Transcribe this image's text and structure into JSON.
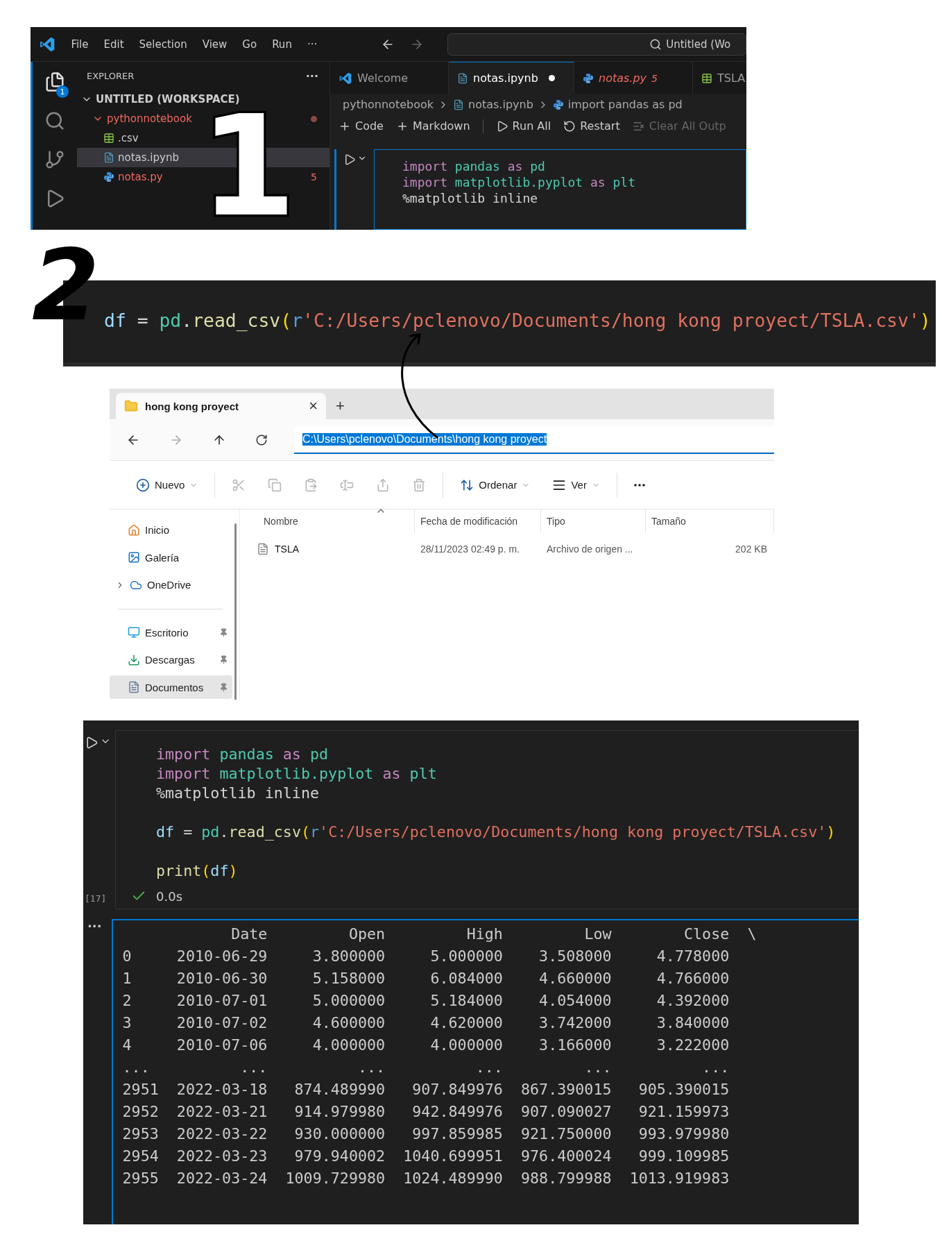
{
  "annotations": {
    "first": "1",
    "second": "2"
  },
  "vscode": {
    "menu": [
      "File",
      "Edit",
      "Selection",
      "View",
      "Go",
      "Run",
      "···"
    ],
    "search": "Untitled (Wo",
    "activity_badge": "1",
    "explorer": {
      "title": "EXPLORER",
      "more": "···",
      "workspace": "UNTITLED (WORKSPACE)",
      "tree": [
        {
          "label": "pythonnotebook",
          "kind": "folder",
          "expanded": true,
          "modified": true,
          "selected": false,
          "children": [
            {
              "label": ".csv",
              "kind": "csv",
              "selected": false
            },
            {
              "label": "notas.ipynb",
              "kind": "notebook",
              "selected": true
            },
            {
              "label": "notas.py",
              "kind": "python",
              "selected": false,
              "modified": true,
              "problems": "5"
            }
          ]
        }
      ]
    },
    "tabs": [
      {
        "label": "Welcome",
        "kind": "welcome",
        "selected": false,
        "dirty": false
      },
      {
        "label": "notas.ipynb",
        "kind": "notebook",
        "selected": true,
        "dirty": true
      },
      {
        "label": "notas.py",
        "kind": "python",
        "selected": false,
        "dirty": false,
        "problems": "5"
      },
      {
        "label": "TSLA.",
        "kind": "csv",
        "selected": false
      }
    ],
    "breadcrumbs": [
      {
        "label": "pythonnotebook",
        "kind": "folder"
      },
      {
        "label": "notas.ipynb",
        "kind": "notebook"
      },
      {
        "label": "import pandas as pd",
        "kind": "python"
      }
    ],
    "toolbar": [
      {
        "label": "Code",
        "kind": "add",
        "disabled": false
      },
      {
        "label": "Markdown",
        "kind": "add",
        "disabled": false
      },
      {
        "label": "Run All",
        "kind": "run",
        "disabled": false
      },
      {
        "label": "Restart",
        "kind": "restart",
        "disabled": false
      },
      {
        "label": "Clear All Outp",
        "kind": "clear",
        "disabled": true
      }
    ],
    "code": [
      {
        "kind": "code",
        "tokens": [
          {
            "kind": "keyword",
            "text": "import "
          },
          {
            "kind": "module",
            "text": "pandas "
          },
          {
            "kind": "keyword",
            "text": "as "
          },
          {
            "kind": "module",
            "text": "pd"
          }
        ]
      },
      {
        "kind": "code",
        "tokens": [
          {
            "kind": "keyword",
            "text": "import "
          },
          {
            "kind": "module",
            "text": "matplotlib.pyplot "
          },
          {
            "kind": "keyword",
            "text": "as "
          },
          {
            "kind": "alias",
            "text": "plt"
          }
        ]
      },
      {
        "kind": "code",
        "tokens": [
          {
            "kind": "plain",
            "text": "%matplotlib inline"
          }
        ]
      }
    ]
  },
  "zoomed_code": {
    "tokens": [
      {
        "kind": "variable",
        "text": "df"
      },
      {
        "kind": "plain",
        "text": " = "
      },
      {
        "kind": "module",
        "text": "pd"
      },
      {
        "kind": "plain",
        "text": "."
      },
      {
        "kind": "function",
        "text": "read_csv"
      },
      {
        "kind": "paren",
        "text": "("
      },
      {
        "kind": "prefix",
        "text": "r"
      },
      {
        "kind": "string",
        "text": "'C:/Users/pclenovo/Documents/hong kong proyect/TSLA.csv'"
      },
      {
        "kind": "paren",
        "text": ")"
      }
    ]
  },
  "file_explorer": {
    "tab": "hong kong proyect",
    "close": "×",
    "new_tab": "+",
    "address": "C:\\Users\\pclenovo\\Documents\\hong kong proyect",
    "toolbar": [
      {
        "kind": "new",
        "label": "Nuevo",
        "disabled": false
      },
      {
        "kind": "cut",
        "disabled": true
      },
      {
        "kind": "copy",
        "disabled": true
      },
      {
        "kind": "paste",
        "disabled": true
      },
      {
        "kind": "rename",
        "disabled": true
      },
      {
        "kind": "share",
        "disabled": true
      },
      {
        "kind": "delete",
        "disabled": true
      },
      {
        "kind": "sort",
        "label": "Ordenar",
        "disabled": false
      },
      {
        "kind": "view",
        "label": "Ver",
        "disabled": false
      },
      {
        "kind": "more",
        "disabled": false
      }
    ],
    "sidebar": [
      {
        "label": "Inicio",
        "kind": "home",
        "pinned": false,
        "selected": false
      },
      {
        "label": "Galería",
        "kind": "gallery",
        "pinned": false,
        "selected": false
      },
      {
        "label": "OneDrive",
        "kind": "cloud",
        "pinned": false,
        "selected": false,
        "expanded": false
      },
      {
        "label": "Escritorio",
        "kind": "desktop",
        "pinned": true,
        "selected": false
      },
      {
        "label": "Descargas",
        "kind": "downloads",
        "pinned": true,
        "selected": false
      },
      {
        "label": "Documentos",
        "kind": "documents",
        "pinned": true,
        "selected": true
      }
    ],
    "columns": [
      {
        "label": "Nombre",
        "sorted": true
      },
      {
        "label": "Fecha de modificación",
        "sorted": false
      },
      {
        "label": "Tipo",
        "sorted": false
      },
      {
        "label": "Tamaño",
        "sorted": false
      }
    ],
    "rows": [
      {
        "name": "TSLA",
        "modified": "28/11/2023 02:49 p. m.",
        "type": "Archivo de origen ...",
        "size": "202 KB",
        "selected": false
      }
    ]
  },
  "notebook": {
    "code": [
      {
        "kind": "code",
        "tokens": [
          {
            "kind": "keyword",
            "text": "import "
          },
          {
            "kind": "module",
            "text": "pandas "
          },
          {
            "kind": "keyword",
            "text": "as "
          },
          {
            "kind": "module",
            "text": "pd"
          }
        ]
      },
      {
        "kind": "code",
        "tokens": [
          {
            "kind": "keyword",
            "text": "import "
          },
          {
            "kind": "module",
            "text": "matplotlib.pyplot "
          },
          {
            "kind": "keyword",
            "text": "as "
          },
          {
            "kind": "alias",
            "text": "plt"
          }
        ]
      },
      {
        "kind": "code",
        "tokens": [
          {
            "kind": "plain",
            "text": "%matplotlib inline"
          }
        ]
      },
      {
        "kind": "blank"
      },
      {
        "kind": "code",
        "tokens": [
          {
            "kind": "variable",
            "text": "df"
          },
          {
            "kind": "plain",
            "text": " = "
          },
          {
            "kind": "module",
            "text": "pd"
          },
          {
            "kind": "plain",
            "text": "."
          },
          {
            "kind": "function",
            "text": "read_csv"
          },
          {
            "kind": "paren",
            "text": "("
          },
          {
            "kind": "prefix",
            "text": "r"
          },
          {
            "kind": "string",
            "text": "'C:/Users/pclenovo/Documents/hong kong proyect/TSLA.csv'"
          },
          {
            "kind": "paren",
            "text": ")"
          }
        ]
      },
      {
        "kind": "blank"
      },
      {
        "kind": "code",
        "tokens": [
          {
            "kind": "function",
            "text": "print"
          },
          {
            "kind": "paren",
            "text": "("
          },
          {
            "kind": "variable",
            "text": "df"
          },
          {
            "kind": "paren",
            "text": ")"
          }
        ]
      }
    ],
    "execution_count": "[17]",
    "succeeded": true,
    "duration": "0.0s",
    "output_more": "···",
    "output": {
      "columns": [
        "",
        "Date",
        "Open",
        "High",
        "Low",
        "Close",
        "\\"
      ],
      "rows": [
        [
          "0",
          "2010-06-29",
          "3.800000",
          "5.000000",
          "3.508000",
          "4.778000"
        ],
        [
          "1",
          "2010-06-30",
          "5.158000",
          "6.084000",
          "4.660000",
          "4.766000"
        ],
        [
          "2",
          "2010-07-01",
          "5.000000",
          "5.184000",
          "4.054000",
          "4.392000"
        ],
        [
          "3",
          "2010-07-02",
          "4.600000",
          "4.620000",
          "3.742000",
          "3.840000"
        ],
        [
          "4",
          "2010-07-06",
          "4.000000",
          "4.000000",
          "3.166000",
          "3.222000"
        ],
        [
          "...",
          "...",
          "...",
          "...",
          "...",
          "..."
        ],
        [
          "2951",
          "2022-03-18",
          "874.489990",
          "907.849976",
          "867.390015",
          "905.390015"
        ],
        [
          "2952",
          "2022-03-21",
          "914.979980",
          "942.849976",
          "907.090027",
          "921.159973"
        ],
        [
          "2953",
          "2022-03-22",
          "930.000000",
          "997.859985",
          "921.750000",
          "993.979980"
        ],
        [
          "2954",
          "2022-03-23",
          "979.940002",
          "1040.699951",
          "976.400024",
          "999.109985"
        ],
        [
          "2955",
          "2022-03-24",
          "1009.729980",
          "1024.489990",
          "988.799988",
          "1013.919983"
        ]
      ]
    }
  }
}
